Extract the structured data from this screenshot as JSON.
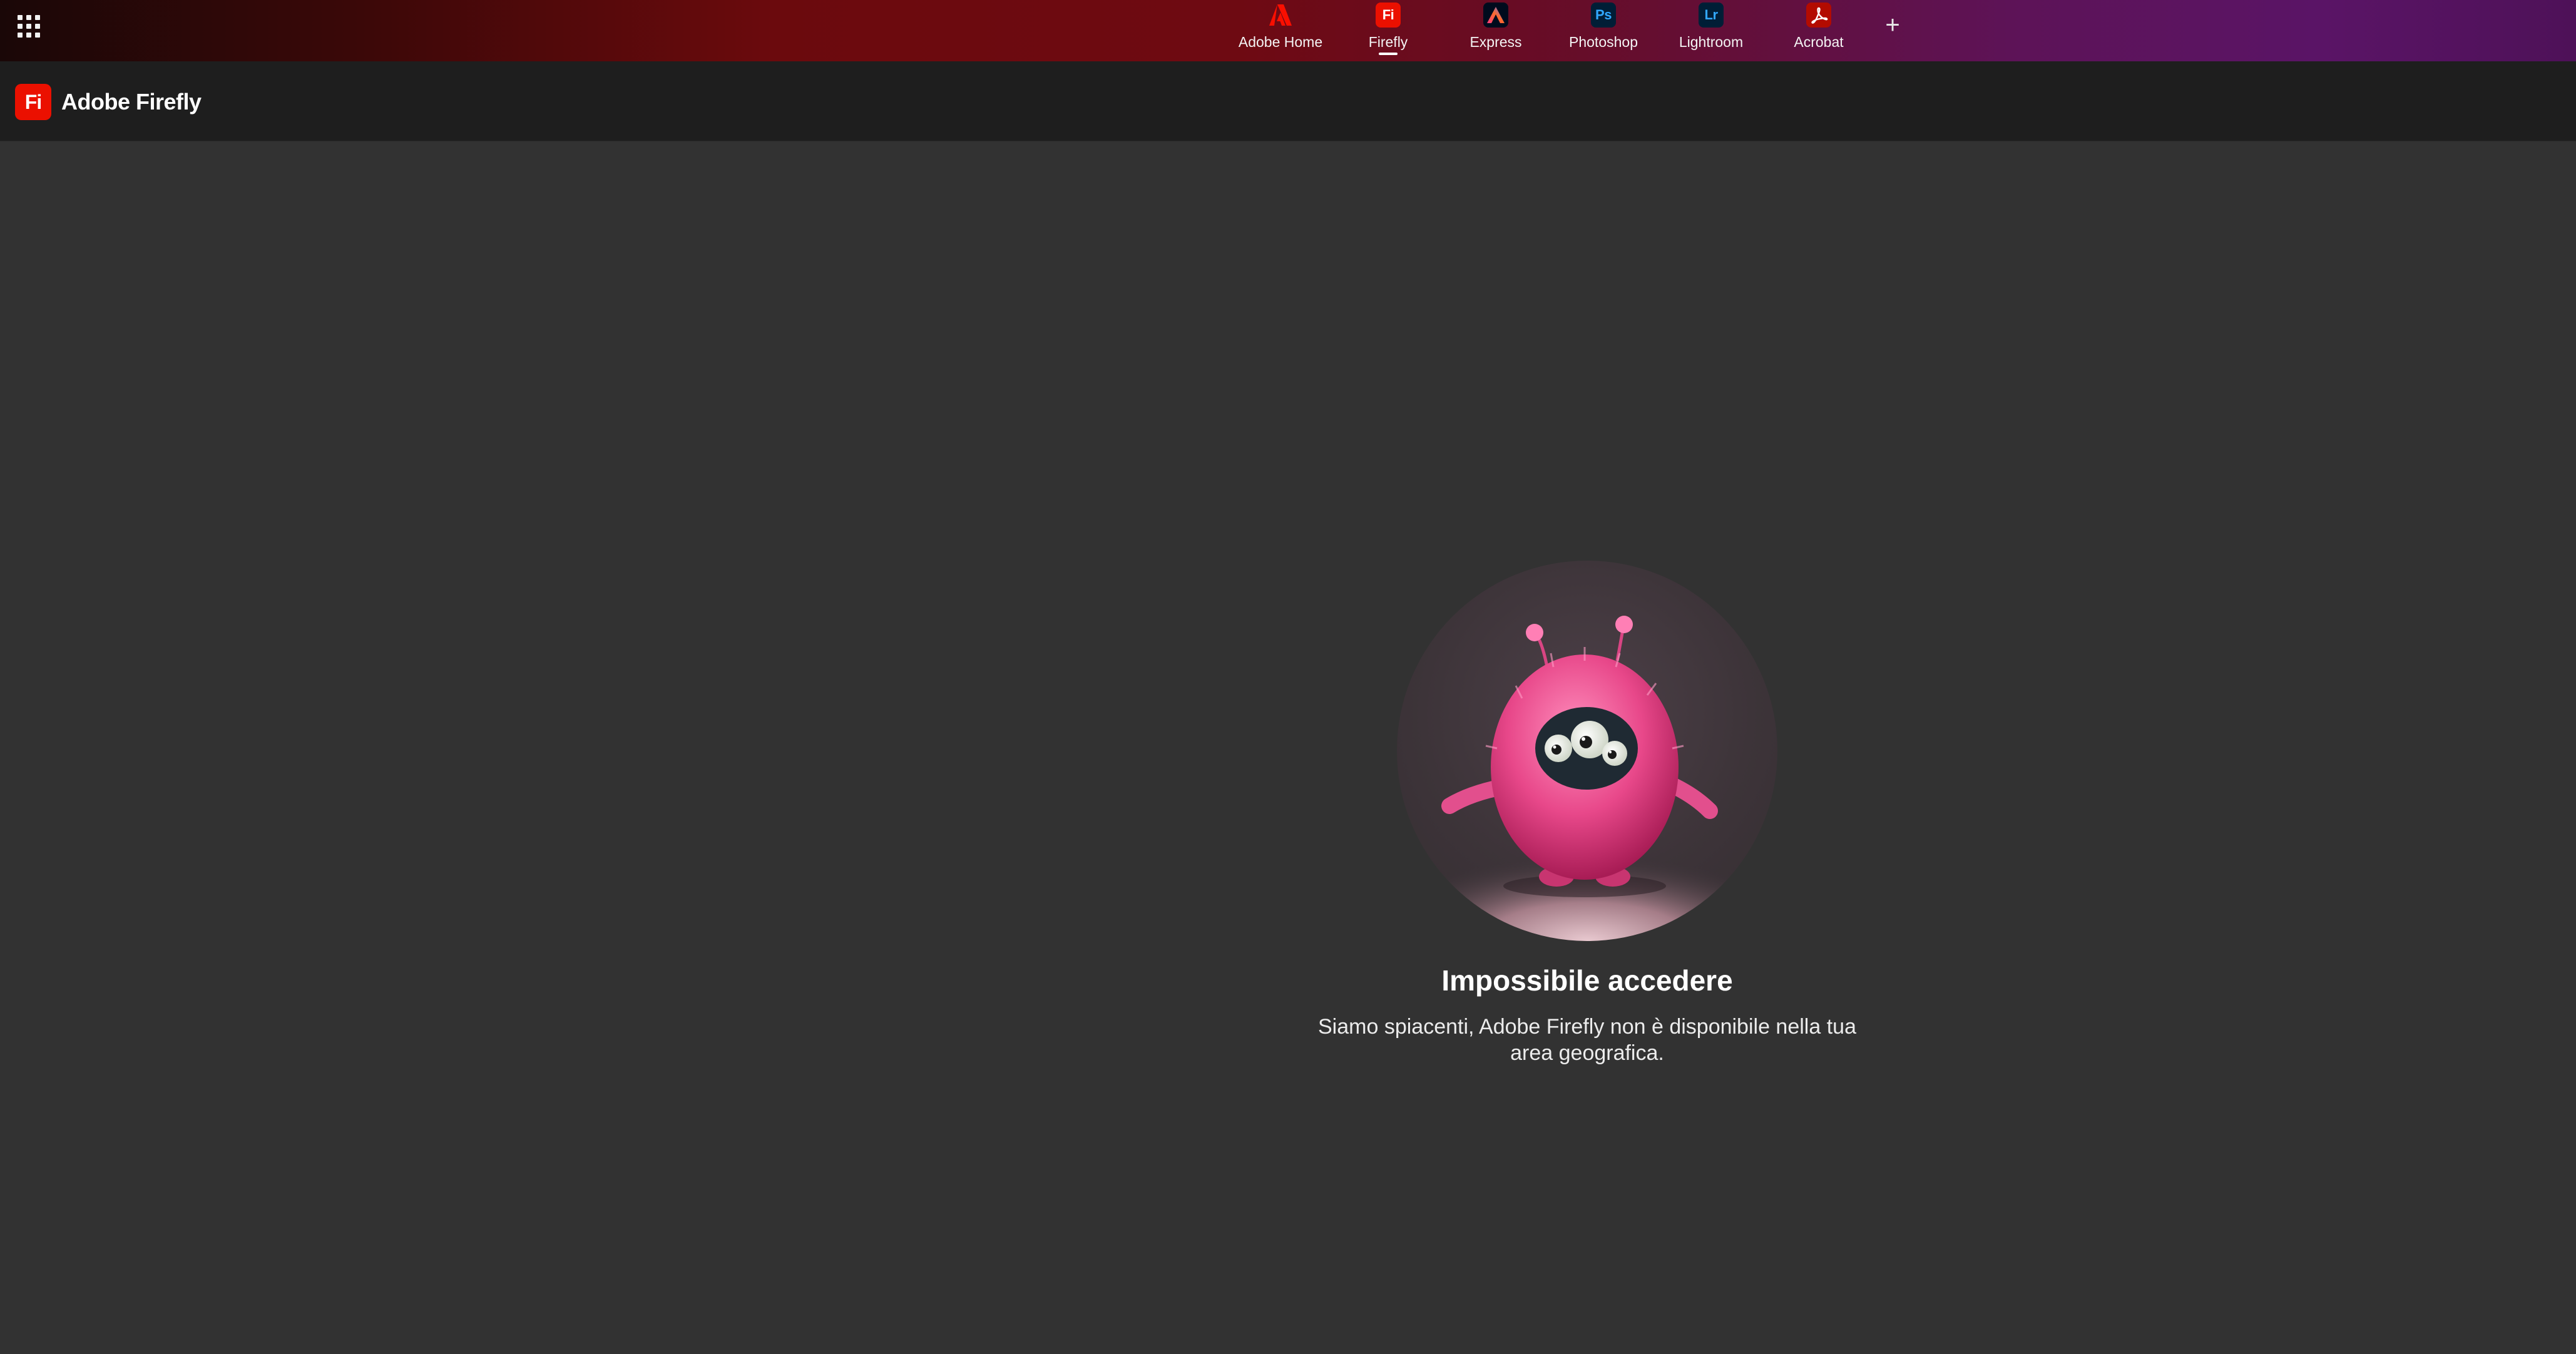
{
  "topbar": {
    "apps": [
      {
        "label": "Adobe Home",
        "icon": "adobe-logo-icon",
        "active": false
      },
      {
        "label": "Firefly",
        "icon": "firefly-icon",
        "glyph": "Fi",
        "active": true
      },
      {
        "label": "Express",
        "icon": "express-icon",
        "active": false
      },
      {
        "label": "Photoshop",
        "icon": "photoshop-icon",
        "glyph": "Ps",
        "active": false
      },
      {
        "label": "Lightroom",
        "icon": "lightroom-icon",
        "glyph": "Lr",
        "active": false
      },
      {
        "label": "Acrobat",
        "icon": "acrobat-icon",
        "active": false
      }
    ],
    "add_label": "+",
    "colors": {
      "firefly": "#eb1000",
      "photoshop_text": "#31a8ff",
      "acrobat": "#b30b00"
    }
  },
  "header": {
    "logo_glyph": "Fi",
    "app_name": "Adobe Firefly"
  },
  "main": {
    "illustration": "pink-fuzzy-monster-illustration",
    "error_title": "Impossibile accedere",
    "error_message": "Siamo spiacenti, Adobe Firefly non è disponibile nella tua area geografica."
  }
}
